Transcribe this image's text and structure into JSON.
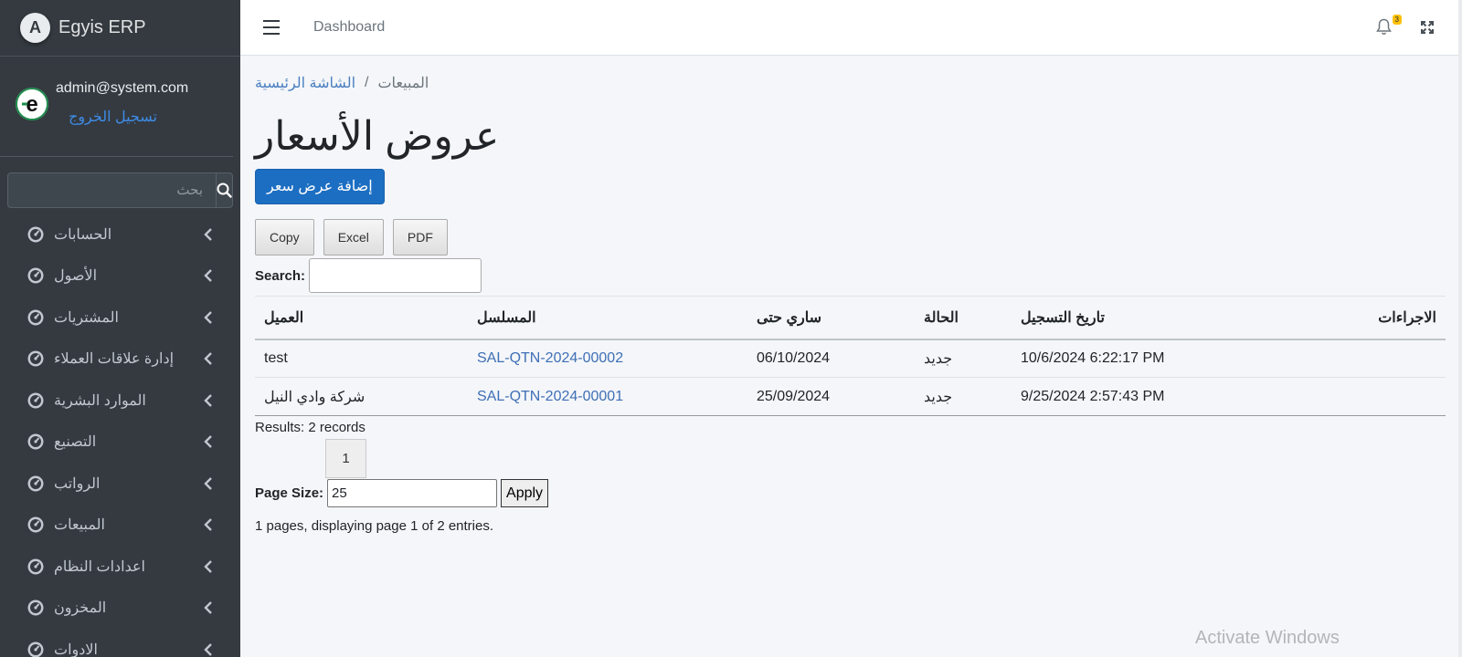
{
  "brand": {
    "name": "Egyis ERP"
  },
  "user": {
    "email": "admin@system.com",
    "logout_label": "تسجيل الخروج"
  },
  "sidebar": {
    "search_placeholder": "بحث",
    "items": [
      {
        "label": "الحسابات"
      },
      {
        "label": "الأصول"
      },
      {
        "label": "المشتريات"
      },
      {
        "label": "إدارة علاقات العملاء"
      },
      {
        "label": "الموارد البشرية"
      },
      {
        "label": "التصنيع"
      },
      {
        "label": "الرواتب"
      },
      {
        "label": "المبيعات"
      },
      {
        "label": "اعدادات النظام"
      },
      {
        "label": "المخزون"
      },
      {
        "label": "الادوات"
      }
    ]
  },
  "topbar": {
    "dashboard_label": "Dashboard",
    "notification_count": "3"
  },
  "breadcrumb": {
    "home": "الشاشة الرئيسية",
    "separator": "/",
    "current": "المبيعات"
  },
  "page": {
    "title": "عروض الأسعار",
    "add_button": "إضافة عرض سعر"
  },
  "export": {
    "copy": "Copy",
    "excel": "Excel",
    "pdf": "PDF"
  },
  "search": {
    "label": "Search:"
  },
  "table": {
    "headers": {
      "customer": "العميل",
      "code": "المسلسل",
      "valid_until": "ساري حتى",
      "status": "الحالة",
      "created": "تاريخ التسجيل",
      "actions": "الاجراءات"
    },
    "rows": [
      {
        "customer": "test",
        "code": "SAL-QTN-2024-00002",
        "valid_until": "06/10/2024",
        "status": "جديد",
        "created": "10/6/2024 6:22:17 PM"
      },
      {
        "customer": "شركة وادي النيل",
        "code": "SAL-QTN-2024-00001",
        "valid_until": "25/09/2024",
        "status": "جديد",
        "created": "9/25/2024 2:57:43 PM"
      }
    ]
  },
  "pagination": {
    "results": "Results: 2 records",
    "current_page": "1",
    "page_size_label": "Page Size:",
    "page_size_value": "25",
    "apply_label": "Apply",
    "summary": "1 pages, displaying page 1 of 2 entries."
  },
  "watermark": {
    "text": "Activate Windows"
  },
  "colors": {
    "sidebar_bg": "#343a40",
    "primary": "#1b6ec2",
    "link": "#3f6fb6"
  }
}
